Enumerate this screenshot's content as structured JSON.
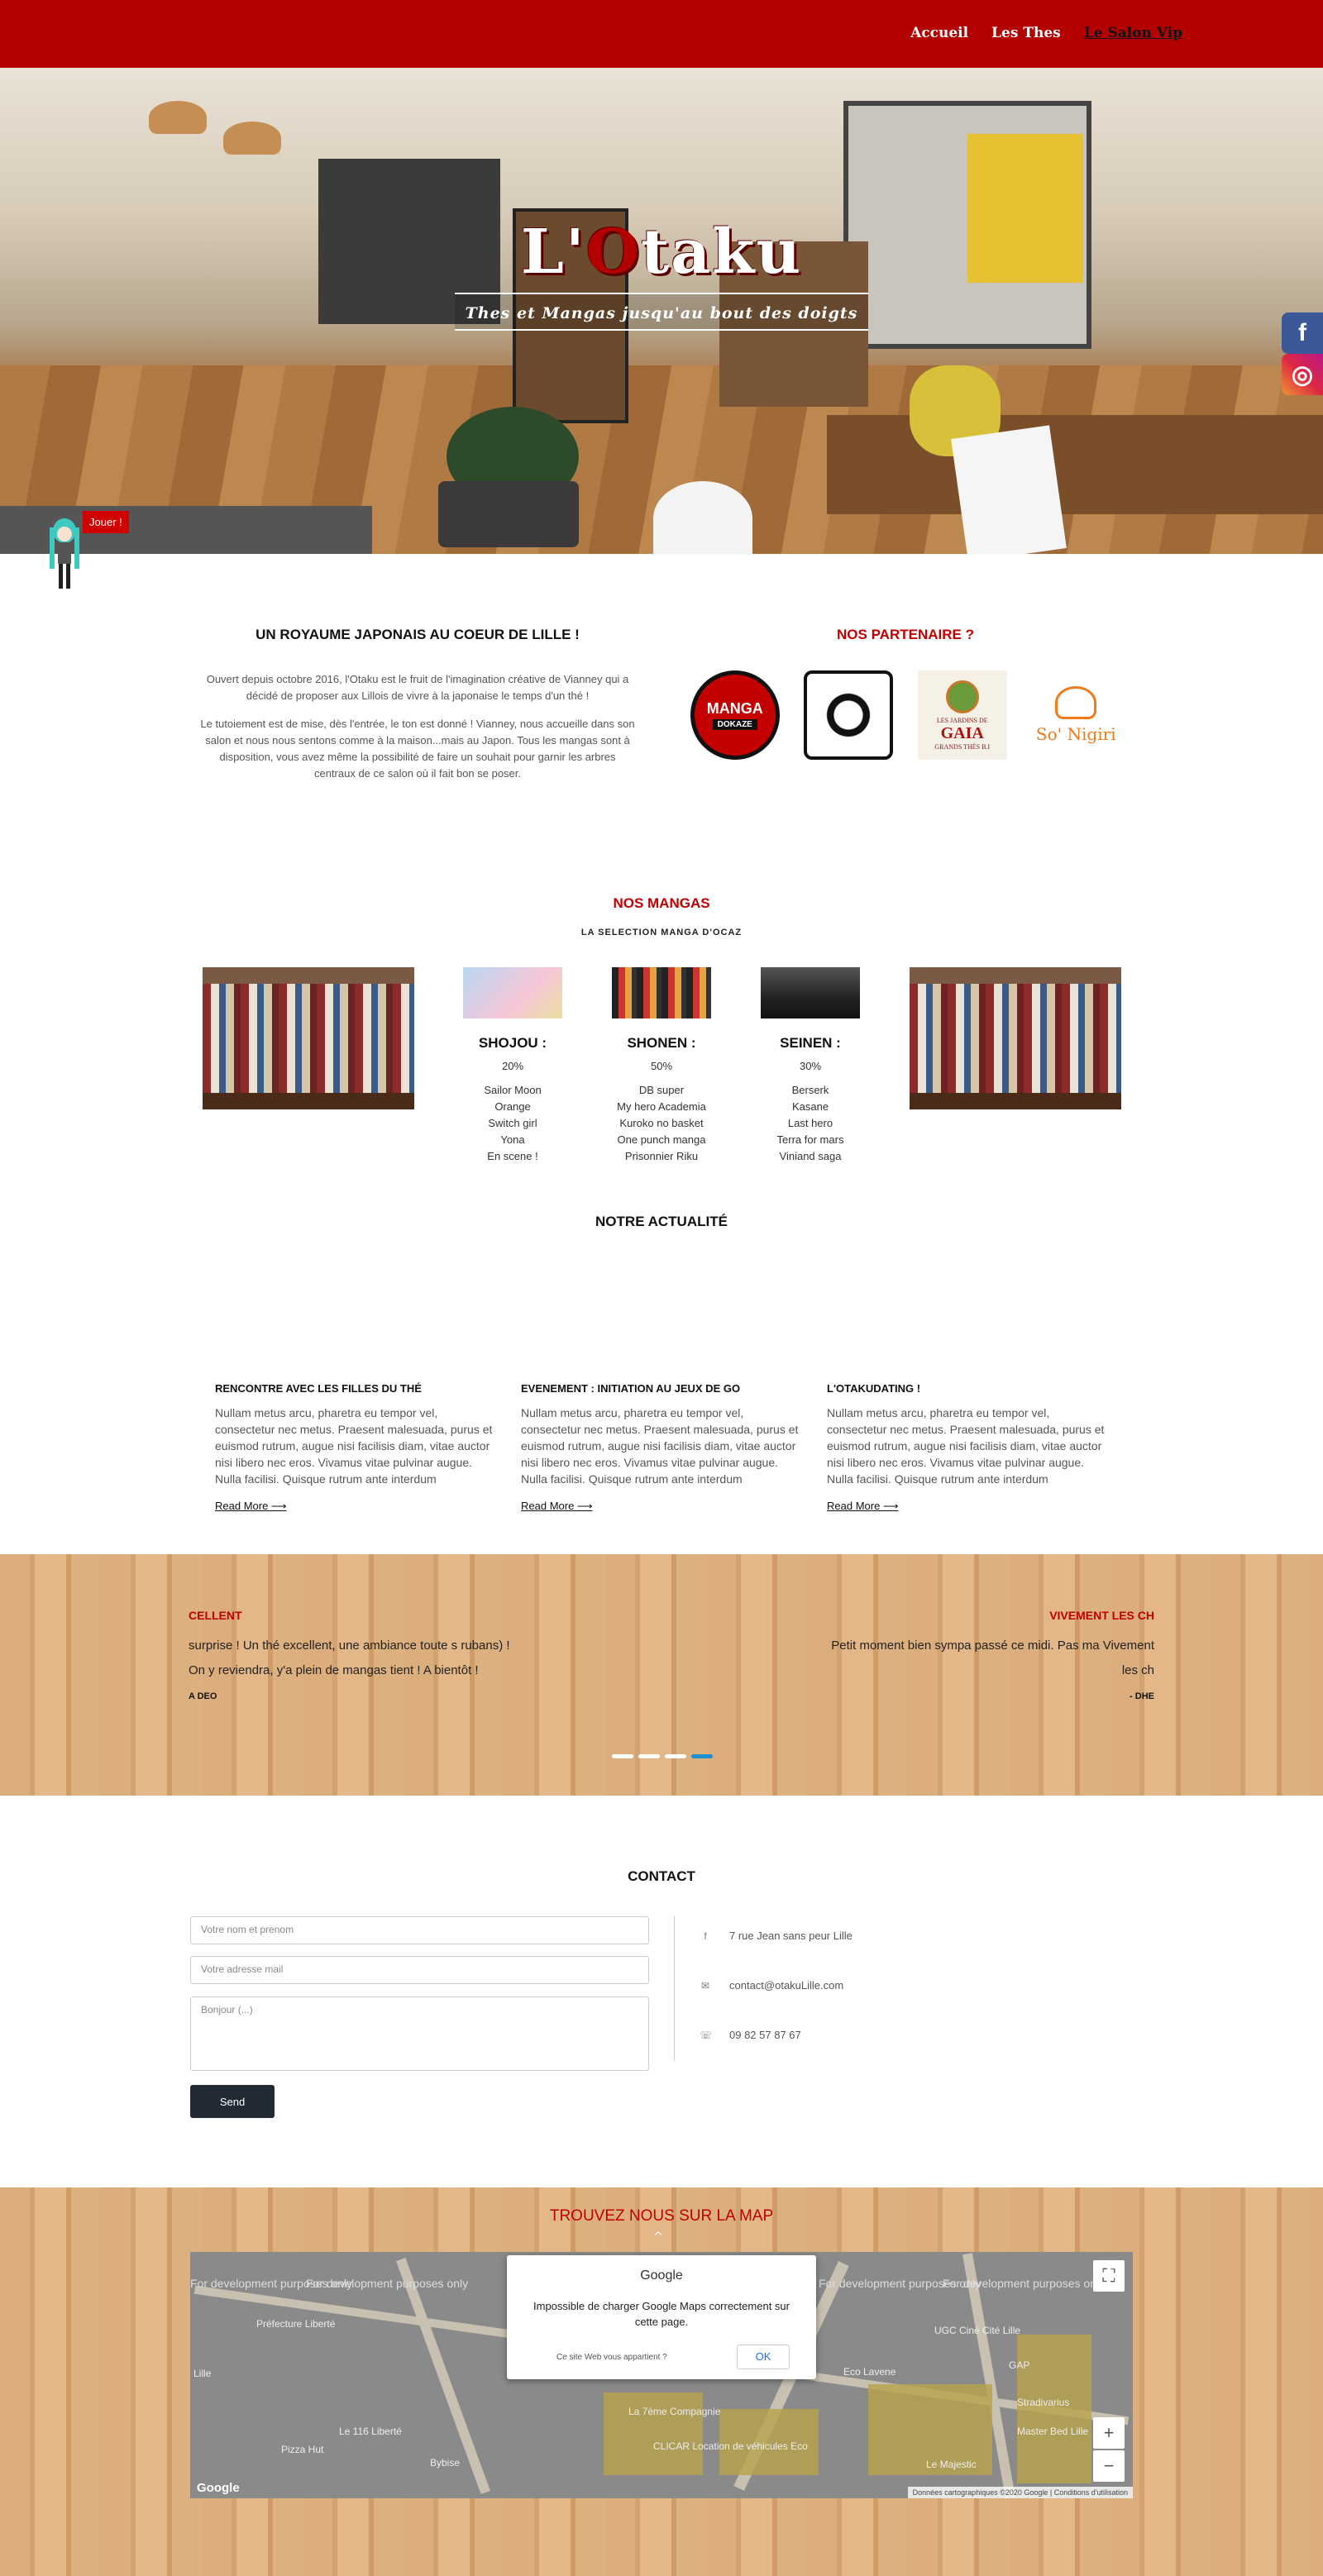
{
  "nav": {
    "items": [
      "Accueil",
      "Les Thes",
      "Le Salon Vip"
    ],
    "active_index": 2
  },
  "hero": {
    "logo": {
      "pre": "L'",
      "o": "O",
      "post": "taku"
    },
    "tagline": "Thes et Mangas jusqu'au bout des doigts"
  },
  "social": {
    "facebook": "f",
    "instagram": "◎"
  },
  "game": {
    "button": "Jouer !"
  },
  "kingdom": {
    "title": "UN ROYAUME JAPONAIS AU COEUR DE LILLE !",
    "paragraphs": [
      "Ouvert depuis octobre 2016, l'Otaku est le fruit de l'imagination créative de Vianney qui a décidé de proposer aux Lillois de vivre à la japonaise le temps d'un thé !",
      "Le tutoiement est de mise, dès l'entrée, le ton est donné ! Vianney, nous accueille dans son salon et nous nous sentons comme à la maison...mais au Japon. Tous les mangas sont à disposition, vous avez même la possibilité de faire un souhait pour garnir les arbres centraux de ce salon où il fait bon se poser."
    ]
  },
  "partners": {
    "title": "NOS PARTENAIRE ?",
    "manga": {
      "top": "MANGA",
      "bottom": "DOKAZE"
    },
    "gaia": {
      "pre": "LES JARDINS DE",
      "name": "GAIA",
      "sub": "GRANDS THÉS B.I"
    },
    "onigiri": "So' Nigiri"
  },
  "mangas": {
    "title": "NOS MANGAS",
    "subtitle": "LA SELECTION MANGA D'OCAZ",
    "categories": [
      {
        "name": "SHOJOU :",
        "pct": "20%",
        "items": [
          "Sailor Moon",
          "Orange",
          "Switch girl",
          "Yona",
          "En scene !"
        ]
      },
      {
        "name": "SHONEN :",
        "pct": "50%",
        "items": [
          "DB super",
          "My hero Academia",
          "Kuroko no basket",
          "One punch manga",
          "Prisonnier Riku"
        ]
      },
      {
        "name": "SEINEN :",
        "pct": "30%",
        "items": [
          "Berserk",
          "Kasane",
          "Last hero",
          "Terra for mars",
          "Viniand saga"
        ]
      }
    ]
  },
  "news": {
    "title": "NOTRE ACTUALITÉ",
    "read_more": "Read More ⟶",
    "cards": [
      {
        "title": "RENCONTRE AVEC LES FILLES DU THÉ",
        "body": "Nullam metus arcu, pharetra eu tempor vel, consectetur nec metus. Praesent malesuada, purus et euismod rutrum, augue nisi facilisis diam, vitae auctor nisi libero nec eros. Vivamus vitae pulvinar augue. Nulla facilisi. Quisque rutrum ante interdum"
      },
      {
        "title": "EVENEMENT : INITIATION AU JEUX DE GO",
        "body": "Nullam metus arcu, pharetra eu tempor vel, consectetur nec metus. Praesent malesuada, purus et euismod rutrum, augue nisi facilisis diam, vitae auctor nisi libero nec eros. Vivamus vitae pulvinar augue. Nulla facilisi. Quisque rutrum ante interdum"
      },
      {
        "title": "L'OTAKUDATING !",
        "body": "Nullam metus arcu, pharetra eu tempor vel, consectetur nec metus. Praesent malesuada, purus et euismod rutrum, augue nisi facilisis diam, vitae auctor nisi libero nec eros. Vivamus vitae pulvinar augue. Nulla facilisi. Quisque rutrum ante interdum"
      }
    ]
  },
  "testimonials": {
    "left": {
      "title": "CELLENT",
      "text": "surprise ! Un thé excellent, une ambiance toute s rubans) ! On y reviendra, y'a plein de mangas tient ! A bientôt !",
      "author": "A DEO"
    },
    "right": {
      "title": "VIVEMENT LES CH",
      "text": "Petit moment bien sympa passé ce midi. Pas ma Vivement les ch",
      "author": "- DHE"
    },
    "slide_count": 4,
    "active_slide": 3
  },
  "contact": {
    "title": "CONTACT",
    "name_placeholder": "Votre nom et prenom",
    "mail_placeholder": "Votre adresse mail",
    "message_placeholder": "Bonjour (...)",
    "send": "Send",
    "address": "7 rue Jean sans peur Lille",
    "email": "contact@otakuLille.com",
    "phone": "09 82 57 87 67"
  },
  "map": {
    "title": "TROUVEZ NOUS SUR LA MAP",
    "dev_text": "For development purposes only",
    "dialog": {
      "brand": "Google",
      "message": "Impossible de charger Google Maps correctement sur cette page.",
      "owner": "Ce site Web vous appartient ?",
      "ok": "OK"
    },
    "labels": [
      "Préfecture Liberté",
      "Lille",
      "Le 116 Liberté",
      "Bybise",
      "La 7ème Compagnie",
      "CLICAR Location de véhicules Eco",
      "Eco Lavene",
      "UGC Ciné Cité Lille",
      "GAP",
      "Stradivarius",
      "Le Majestic",
      "Master Bed Lille",
      "Pizza Hut"
    ],
    "attribution": "Données cartographiques ©2020 Google | Conditions d'utilisation",
    "google_mark": "Google"
  },
  "colors": {
    "brand_red": "#b30000",
    "accent_red": "#c00000",
    "dark_button": "#222b33",
    "slider_active": "#1e90d0"
  }
}
